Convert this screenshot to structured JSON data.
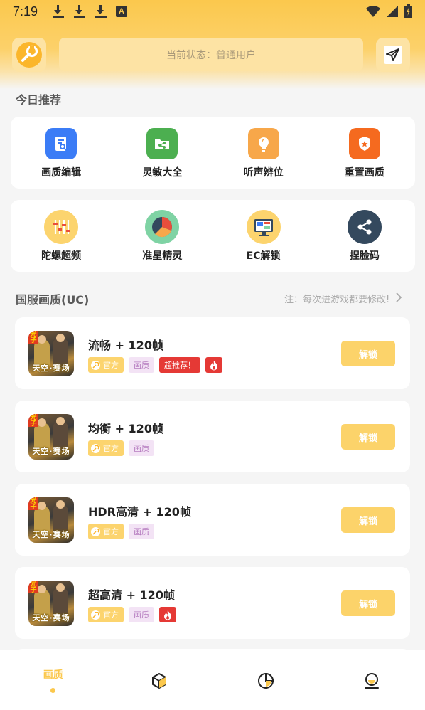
{
  "status_bar": {
    "time": "7:19",
    "text_icon": "A"
  },
  "header": {
    "status_text": "当前状态：普通用户"
  },
  "today_section": {
    "title": "今日推荐"
  },
  "grid_row1": [
    {
      "label": "画质编辑",
      "icon": "edit-doc-icon",
      "color": "#3b7cf6"
    },
    {
      "label": "灵敏大全",
      "icon": "share-folder-icon",
      "color": "#4caf50"
    },
    {
      "label": "听声辨位",
      "icon": "lightbulb-icon",
      "color": "#f7a74a"
    },
    {
      "label": "重置画质",
      "icon": "shield-star-icon",
      "color": "#f56a1f"
    }
  ],
  "grid_row2": [
    {
      "label": "陀螺超频",
      "icon": "equalizer-icon",
      "color": "#fcd46e"
    },
    {
      "label": "准星精灵",
      "icon": "pie-chart-icon",
      "color": "#7fd3a4"
    },
    {
      "label": "EC解锁",
      "icon": "monitor-icon",
      "color": "#fcd46e"
    },
    {
      "label": "捏脸码",
      "icon": "share-nodes-icon",
      "color": "#34495e"
    }
  ],
  "uc_section": {
    "title": "国服画质(UC)",
    "note": "注：每次进游戏都要修改!"
  },
  "game_caption": {
    "corner": "光子",
    "caption": "天空·赛场"
  },
  "items": [
    {
      "title": "流畅 + 120帧",
      "tag_official": "官方",
      "tag_gfx": "画质",
      "tag_rec": "超推荐！",
      "hot": true,
      "button": "解锁"
    },
    {
      "title": "均衡 + 120帧",
      "tag_official": "官方",
      "tag_gfx": "画质",
      "tag_rec": "",
      "hot": false,
      "button": "解锁"
    },
    {
      "title": "HDR高清 + 120帧",
      "tag_official": "官方",
      "tag_gfx": "画质",
      "tag_rec": "",
      "hot": false,
      "button": "解锁"
    },
    {
      "title": "超高清 + 120帧",
      "tag_official": "官方",
      "tag_gfx": "画质",
      "tag_rec": "",
      "hot": true,
      "button": "解锁"
    }
  ],
  "bottom_nav": {
    "active_label": "画质",
    "items": [
      "cube-icon",
      "pie-icon",
      "profile-icon"
    ]
  },
  "colors": {
    "accent": "#fbc84d",
    "hot": "#e53935",
    "tag_gfx_bg": "#f3e3f5"
  }
}
